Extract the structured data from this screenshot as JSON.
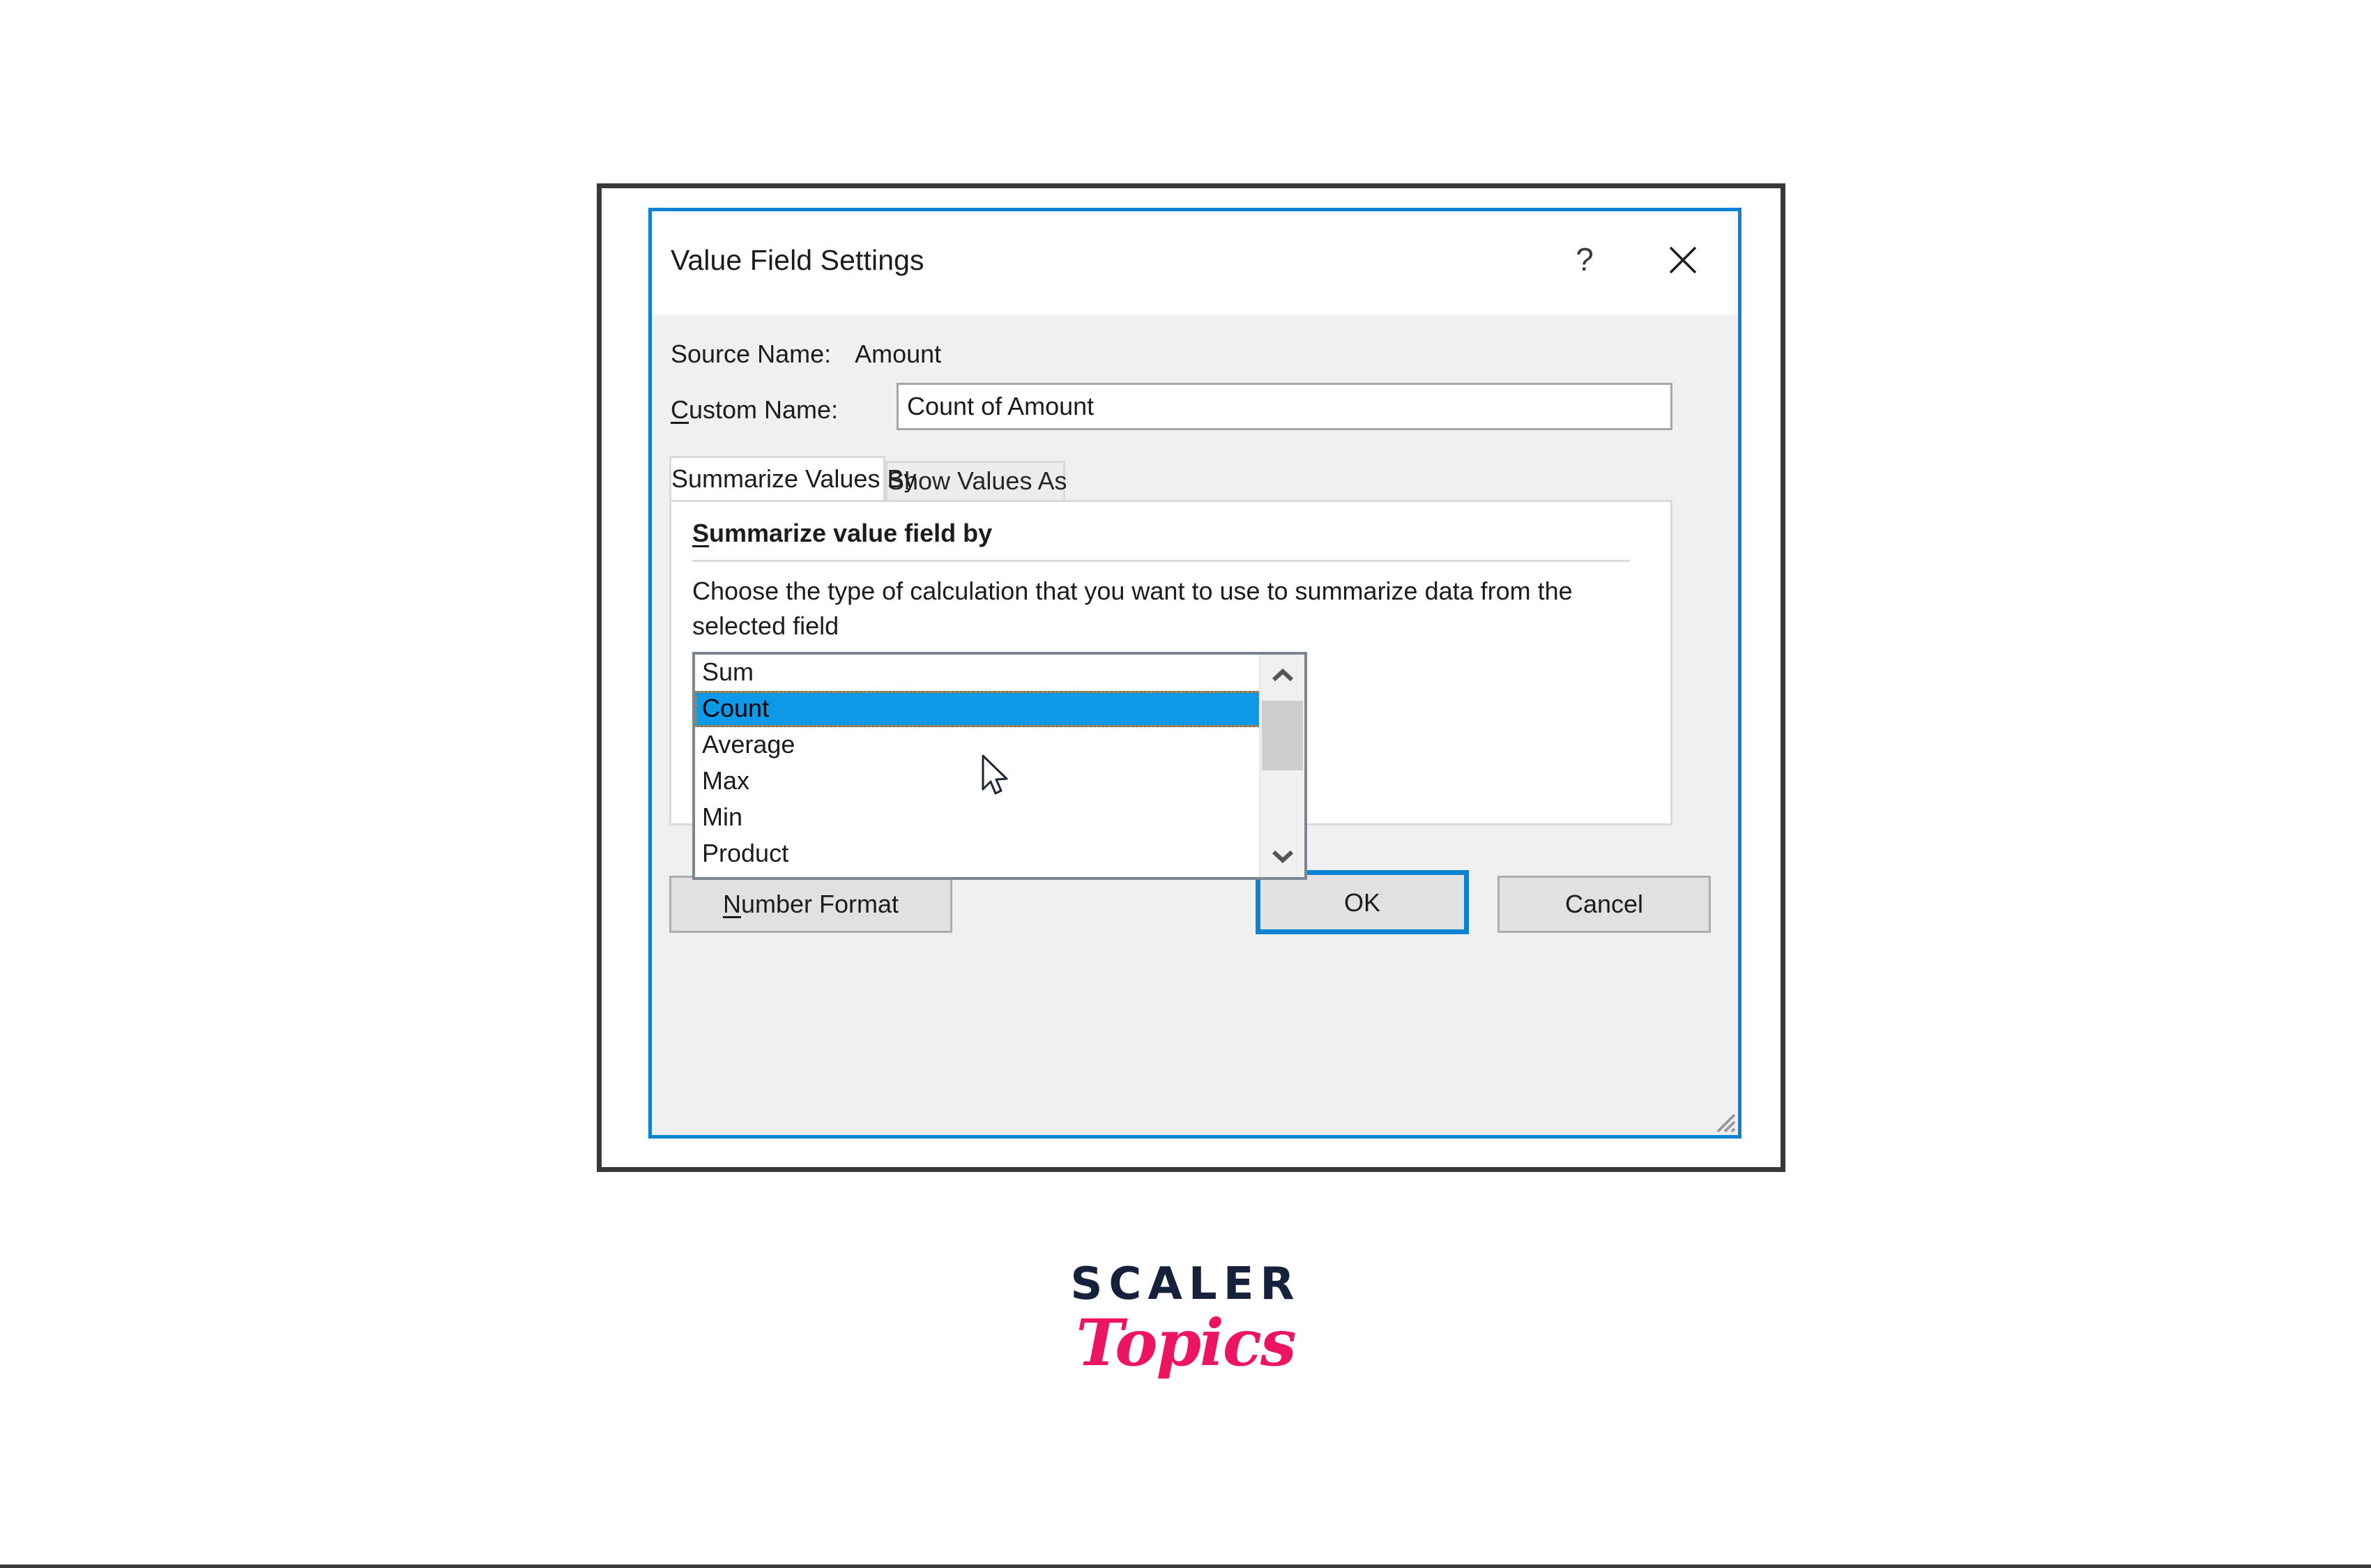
{
  "dialog": {
    "title": "Value Field Settings",
    "help_icon": "question-mark-icon",
    "close_icon": "close-icon",
    "source_name_label": "Source Name:",
    "source_name_value": "Amount",
    "custom_name_label_accel": "C",
    "custom_name_label_rest": "ustom Name:",
    "custom_name_value": "Count of Amount",
    "custom_name_placeholder": "",
    "tabs": [
      {
        "label": "Summarize Values By",
        "active": true
      },
      {
        "label": "Show Values As",
        "active": false
      }
    ],
    "panel": {
      "heading_accel": "S",
      "heading_rest": "ummarize value field by",
      "description": "Choose the type of calculation that you want to use to summarize data from the selected field",
      "listbox": {
        "items": [
          "Sum",
          "Count",
          "Average",
          "Max",
          "Min",
          "Product"
        ],
        "selected": "Count",
        "scroll_up_icon": "chevron-up-icon",
        "scroll_down_icon": "chevron-down-icon"
      }
    },
    "buttons": {
      "number_format_accel": "N",
      "number_format_rest": "umber Format",
      "ok": "OK",
      "cancel": "Cancel"
    },
    "resize_grip_icon": "resize-grip-icon",
    "colors": {
      "accent_blue": "#0c82d4",
      "selection_blue": "#0c9ae8",
      "focus_outline_orange": "#e07818",
      "dialog_background": "#f0f0f0",
      "panel_background": "#ffffff"
    }
  },
  "brand": {
    "primary": "SCALER",
    "secondary": "Topics",
    "primary_color": "#16213c",
    "secondary_color": "#ec1561"
  }
}
